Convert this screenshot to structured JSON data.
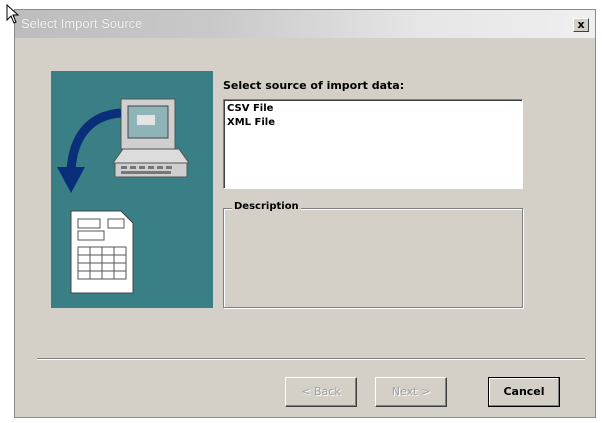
{
  "window": {
    "title": "Select Import Source",
    "close_label": "x"
  },
  "source": {
    "label": "Select source of import data:",
    "items": [
      "CSV File",
      "XML File"
    ]
  },
  "description": {
    "label": "Description",
    "text": ""
  },
  "buttons": {
    "back": "< Back",
    "next": "Next >",
    "cancel": "Cancel"
  },
  "colors": {
    "art_panel": "#3a7f86",
    "dialog_bg": "#d4d0c8"
  },
  "icons": [
    "mouse-cursor-icon",
    "computer-icon",
    "import-arrow-icon",
    "document-icon"
  ]
}
